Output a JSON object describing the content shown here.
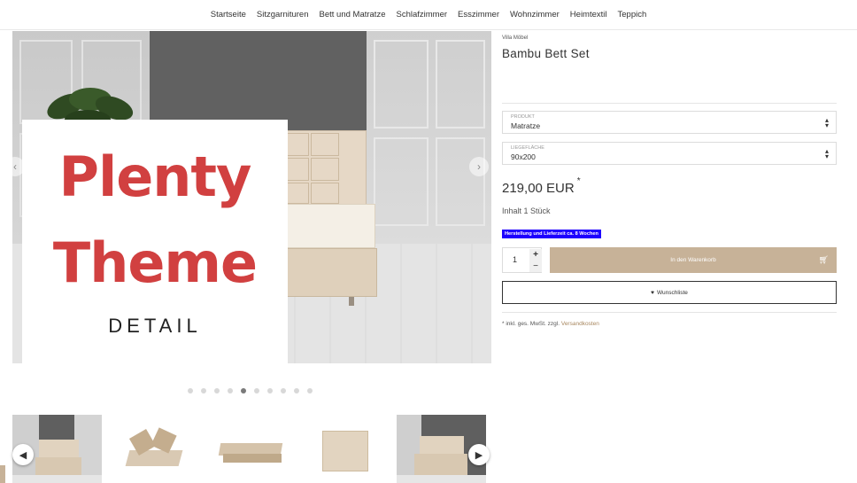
{
  "nav": {
    "items": [
      "Startseite",
      "Sitzgarnituren",
      "Bett und Matratze",
      "Schlafzimmer",
      "Esszimmer",
      "Wohnzimmer",
      "Heimtextil",
      "Teppich"
    ]
  },
  "gallery": {
    "promo": {
      "line1": "Plenty",
      "line2": "Theme",
      "line3": "DETAIL"
    },
    "dot_count": 10,
    "active_dot": 5,
    "prev_icon": "chevron-left-icon",
    "next_icon": "chevron-right-icon"
  },
  "product": {
    "brand": "Villa Möbel",
    "title": "Bambu Bett Set",
    "attributes": [
      {
        "label": "PRODUKT",
        "value": "Matratze"
      },
      {
        "label": "LIEGEFLÄCHE",
        "value": "90x200"
      }
    ],
    "price": "219,00 EUR",
    "price_mark": "*",
    "content": "Inhalt 1 Stück",
    "availability": "Herstellung und Lieferzeit ca. 8 Wochen",
    "quantity": "1",
    "qty_plus": "+",
    "qty_minus": "−",
    "add_to_cart": "In den Warenkorb",
    "wishlist": "Wunschliste",
    "vat_note": "* inkl. ges. MwSt. zzgl.",
    "shipping_link": "Versandkosten"
  },
  "colors": {
    "accent": "#c7b298",
    "badge": "#1e00ff",
    "promo_red": "#d14040",
    "link": "#a8875f"
  }
}
